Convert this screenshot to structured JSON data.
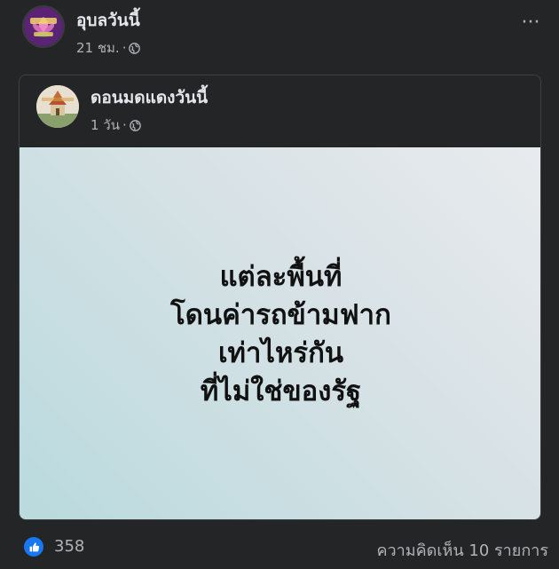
{
  "outer_post": {
    "page_name": "อุบลวันนี้",
    "time": "21 ชม.",
    "dot": "·",
    "more_label": "···",
    "avatar_icon": "lotus-logo-icon",
    "avatar_caption": "อุบลวันนี้"
  },
  "shared_post": {
    "page_name": "ดอนมดแดงวันนี้",
    "time": "1 วัน",
    "dot": "·",
    "avatar_icon": "temple-logo-icon",
    "avatar_caption": "ดอนมดแดงวันนี้",
    "text_lines": [
      "แต่ละพื้นที่",
      "โดนค่ารถข้ามฟาก",
      "เท่าไหร่กัน",
      "ที่ไม่ใช่ของรัฐ"
    ]
  },
  "footer": {
    "like_icon": "thumbs-up-icon",
    "like_count": "358",
    "comments": "ความคิดเห็น 10 รายการ"
  },
  "colors": {
    "background": "#242526",
    "text_primary": "#e4e6eb",
    "text_secondary": "#b0b3b8",
    "like_blue": "#1877f2"
  }
}
